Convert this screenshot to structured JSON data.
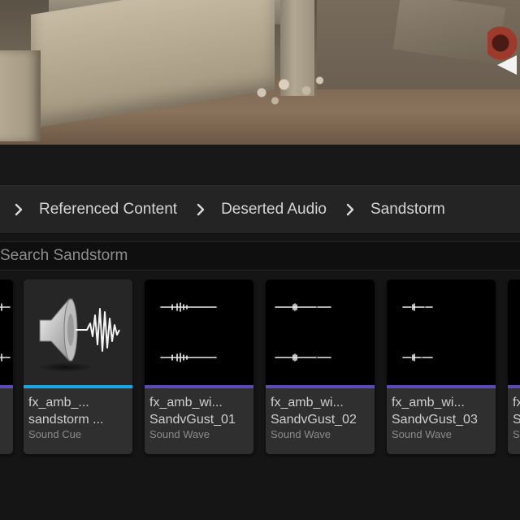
{
  "breadcrumb": {
    "items": [
      "Referenced Content",
      "Deserted Audio",
      "Sandstorm"
    ]
  },
  "search": {
    "placeholder": "Search Sandstorm"
  },
  "assets": [
    {
      "name1": "",
      "name2": "",
      "kind": ""
    },
    {
      "name1": "fx_amb_...",
      "name2": "sandstorm ...",
      "kind": "Sound Cue"
    },
    {
      "name1": "fx_amb_wi...",
      "name2": "SandvGust_01",
      "kind": "Sound Wave"
    },
    {
      "name1": "fx_amb_wi...",
      "name2": "SandvGust_02",
      "kind": "Sound Wave"
    },
    {
      "name1": "fx_amb_wi...",
      "name2": "SandvGust_03",
      "kind": "Sound Wave"
    },
    {
      "name1": "fx",
      "name2": "S",
      "kind": "S"
    }
  ],
  "colors": {
    "sound_cue_bar": "#1aa7e6",
    "sound_wave_bar": "#5a4bb5",
    "panel_bg": "#151515",
    "tile_bg": "#2f2f2f"
  },
  "icons": {
    "breadcrumb_separator": "chevron-right-icon",
    "sound_cue_thumbnail": "speaker-waveform-icon",
    "sound_wave_thumbnail": "waveform-icon"
  }
}
